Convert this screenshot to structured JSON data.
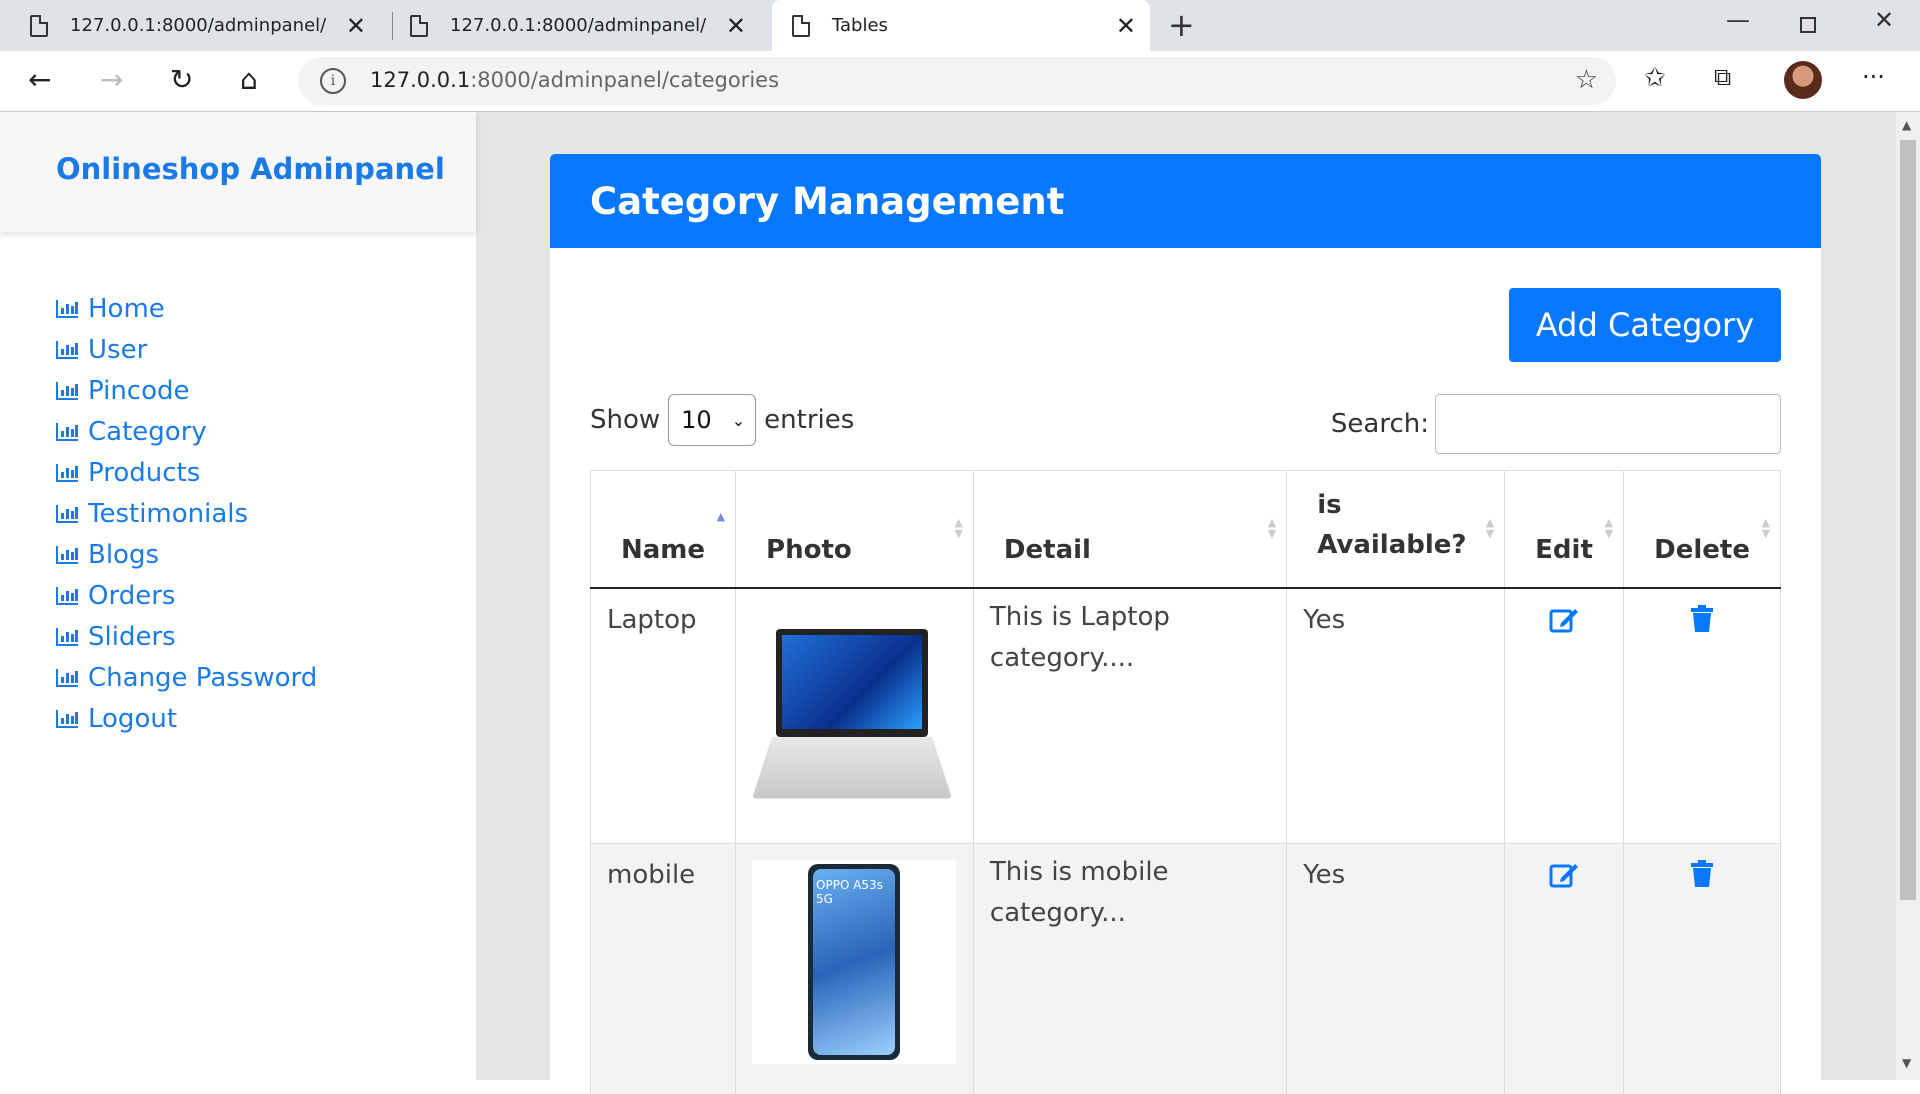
{
  "browser": {
    "tabs": [
      {
        "title": "127.0.0.1:8000/adminpanel/"
      },
      {
        "title": "127.0.0.1:8000/adminpanel/"
      },
      {
        "title": "Tables"
      }
    ],
    "url_host": "127.0.0.1",
    "url_rest": ":8000/adminpanel/categories"
  },
  "sidebar": {
    "brand": "Onlineshop Adminpanel",
    "items": [
      {
        "label": "Home"
      },
      {
        "label": "User"
      },
      {
        "label": "Pincode"
      },
      {
        "label": "Category"
      },
      {
        "label": "Products"
      },
      {
        "label": "Testimonials"
      },
      {
        "label": "Blogs"
      },
      {
        "label": "Orders"
      },
      {
        "label": "Sliders"
      },
      {
        "label": "Change Password"
      },
      {
        "label": "Logout"
      }
    ]
  },
  "main": {
    "title": "Category Management",
    "add_button": "Add Category",
    "show_label": "Show",
    "entries_value": "10",
    "entries_label": "entries",
    "search_label": "Search:",
    "columns": [
      "Name",
      "Photo",
      "Detail",
      "is Available?",
      "Edit",
      "Delete"
    ],
    "rows": [
      {
        "name": "Laptop",
        "detail": "This is Laptop category....",
        "available": "Yes"
      },
      {
        "name": "mobile",
        "detail": "This is mobile category...",
        "available": "Yes",
        "phone_text": "OPPO A53s 5G"
      }
    ]
  },
  "colors": {
    "accent": "#0678ff",
    "link": "#1a7be8"
  }
}
